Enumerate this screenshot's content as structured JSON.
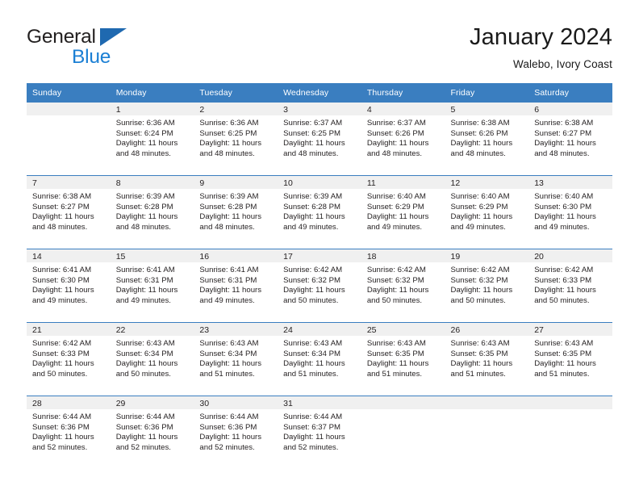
{
  "brand": {
    "name_top": "General",
    "name_bottom": "Blue",
    "triangle_color": "#1f69b0",
    "blue_color": "#1b7fd4"
  },
  "header": {
    "title": "January 2024",
    "subtitle": "Walebo, Ivory Coast"
  },
  "theme": {
    "header_row_bg": "#3a7ec0",
    "daynum_band_bg": "#f0f0f0",
    "grid_line": "#3a7ec0",
    "text": "#231f20"
  },
  "calendar": {
    "weekday_headers": [
      "Sunday",
      "Monday",
      "Tuesday",
      "Wednesday",
      "Thursday",
      "Friday",
      "Saturday"
    ],
    "weeks": [
      [
        {
          "day": "",
          "sunrise": "",
          "sunset": "",
          "daylight1": "",
          "daylight2": ""
        },
        {
          "day": "1",
          "sunrise": "Sunrise: 6:36 AM",
          "sunset": "Sunset: 6:24 PM",
          "daylight1": "Daylight: 11 hours",
          "daylight2": "and 48 minutes."
        },
        {
          "day": "2",
          "sunrise": "Sunrise: 6:36 AM",
          "sunset": "Sunset: 6:25 PM",
          "daylight1": "Daylight: 11 hours",
          "daylight2": "and 48 minutes."
        },
        {
          "day": "3",
          "sunrise": "Sunrise: 6:37 AM",
          "sunset": "Sunset: 6:25 PM",
          "daylight1": "Daylight: 11 hours",
          "daylight2": "and 48 minutes."
        },
        {
          "day": "4",
          "sunrise": "Sunrise: 6:37 AM",
          "sunset": "Sunset: 6:26 PM",
          "daylight1": "Daylight: 11 hours",
          "daylight2": "and 48 minutes."
        },
        {
          "day": "5",
          "sunrise": "Sunrise: 6:38 AM",
          "sunset": "Sunset: 6:26 PM",
          "daylight1": "Daylight: 11 hours",
          "daylight2": "and 48 minutes."
        },
        {
          "day": "6",
          "sunrise": "Sunrise: 6:38 AM",
          "sunset": "Sunset: 6:27 PM",
          "daylight1": "Daylight: 11 hours",
          "daylight2": "and 48 minutes."
        }
      ],
      [
        {
          "day": "7",
          "sunrise": "Sunrise: 6:38 AM",
          "sunset": "Sunset: 6:27 PM",
          "daylight1": "Daylight: 11 hours",
          "daylight2": "and 48 minutes."
        },
        {
          "day": "8",
          "sunrise": "Sunrise: 6:39 AM",
          "sunset": "Sunset: 6:28 PM",
          "daylight1": "Daylight: 11 hours",
          "daylight2": "and 48 minutes."
        },
        {
          "day": "9",
          "sunrise": "Sunrise: 6:39 AM",
          "sunset": "Sunset: 6:28 PM",
          "daylight1": "Daylight: 11 hours",
          "daylight2": "and 48 minutes."
        },
        {
          "day": "10",
          "sunrise": "Sunrise: 6:39 AM",
          "sunset": "Sunset: 6:28 PM",
          "daylight1": "Daylight: 11 hours",
          "daylight2": "and 49 minutes."
        },
        {
          "day": "11",
          "sunrise": "Sunrise: 6:40 AM",
          "sunset": "Sunset: 6:29 PM",
          "daylight1": "Daylight: 11 hours",
          "daylight2": "and 49 minutes."
        },
        {
          "day": "12",
          "sunrise": "Sunrise: 6:40 AM",
          "sunset": "Sunset: 6:29 PM",
          "daylight1": "Daylight: 11 hours",
          "daylight2": "and 49 minutes."
        },
        {
          "day": "13",
          "sunrise": "Sunrise: 6:40 AM",
          "sunset": "Sunset: 6:30 PM",
          "daylight1": "Daylight: 11 hours",
          "daylight2": "and 49 minutes."
        }
      ],
      [
        {
          "day": "14",
          "sunrise": "Sunrise: 6:41 AM",
          "sunset": "Sunset: 6:30 PM",
          "daylight1": "Daylight: 11 hours",
          "daylight2": "and 49 minutes."
        },
        {
          "day": "15",
          "sunrise": "Sunrise: 6:41 AM",
          "sunset": "Sunset: 6:31 PM",
          "daylight1": "Daylight: 11 hours",
          "daylight2": "and 49 minutes."
        },
        {
          "day": "16",
          "sunrise": "Sunrise: 6:41 AM",
          "sunset": "Sunset: 6:31 PM",
          "daylight1": "Daylight: 11 hours",
          "daylight2": "and 49 minutes."
        },
        {
          "day": "17",
          "sunrise": "Sunrise: 6:42 AM",
          "sunset": "Sunset: 6:32 PM",
          "daylight1": "Daylight: 11 hours",
          "daylight2": "and 50 minutes."
        },
        {
          "day": "18",
          "sunrise": "Sunrise: 6:42 AM",
          "sunset": "Sunset: 6:32 PM",
          "daylight1": "Daylight: 11 hours",
          "daylight2": "and 50 minutes."
        },
        {
          "day": "19",
          "sunrise": "Sunrise: 6:42 AM",
          "sunset": "Sunset: 6:32 PM",
          "daylight1": "Daylight: 11 hours",
          "daylight2": "and 50 minutes."
        },
        {
          "day": "20",
          "sunrise": "Sunrise: 6:42 AM",
          "sunset": "Sunset: 6:33 PM",
          "daylight1": "Daylight: 11 hours",
          "daylight2": "and 50 minutes."
        }
      ],
      [
        {
          "day": "21",
          "sunrise": "Sunrise: 6:42 AM",
          "sunset": "Sunset: 6:33 PM",
          "daylight1": "Daylight: 11 hours",
          "daylight2": "and 50 minutes."
        },
        {
          "day": "22",
          "sunrise": "Sunrise: 6:43 AM",
          "sunset": "Sunset: 6:34 PM",
          "daylight1": "Daylight: 11 hours",
          "daylight2": "and 50 minutes."
        },
        {
          "day": "23",
          "sunrise": "Sunrise: 6:43 AM",
          "sunset": "Sunset: 6:34 PM",
          "daylight1": "Daylight: 11 hours",
          "daylight2": "and 51 minutes."
        },
        {
          "day": "24",
          "sunrise": "Sunrise: 6:43 AM",
          "sunset": "Sunset: 6:34 PM",
          "daylight1": "Daylight: 11 hours",
          "daylight2": "and 51 minutes."
        },
        {
          "day": "25",
          "sunrise": "Sunrise: 6:43 AM",
          "sunset": "Sunset: 6:35 PM",
          "daylight1": "Daylight: 11 hours",
          "daylight2": "and 51 minutes."
        },
        {
          "day": "26",
          "sunrise": "Sunrise: 6:43 AM",
          "sunset": "Sunset: 6:35 PM",
          "daylight1": "Daylight: 11 hours",
          "daylight2": "and 51 minutes."
        },
        {
          "day": "27",
          "sunrise": "Sunrise: 6:43 AM",
          "sunset": "Sunset: 6:35 PM",
          "daylight1": "Daylight: 11 hours",
          "daylight2": "and 51 minutes."
        }
      ],
      [
        {
          "day": "28",
          "sunrise": "Sunrise: 6:44 AM",
          "sunset": "Sunset: 6:36 PM",
          "daylight1": "Daylight: 11 hours",
          "daylight2": "and 52 minutes."
        },
        {
          "day": "29",
          "sunrise": "Sunrise: 6:44 AM",
          "sunset": "Sunset: 6:36 PM",
          "daylight1": "Daylight: 11 hours",
          "daylight2": "and 52 minutes."
        },
        {
          "day": "30",
          "sunrise": "Sunrise: 6:44 AM",
          "sunset": "Sunset: 6:36 PM",
          "daylight1": "Daylight: 11 hours",
          "daylight2": "and 52 minutes."
        },
        {
          "day": "31",
          "sunrise": "Sunrise: 6:44 AM",
          "sunset": "Sunset: 6:37 PM",
          "daylight1": "Daylight: 11 hours",
          "daylight2": "and 52 minutes."
        },
        {
          "day": "",
          "sunrise": "",
          "sunset": "",
          "daylight1": "",
          "daylight2": ""
        },
        {
          "day": "",
          "sunrise": "",
          "sunset": "",
          "daylight1": "",
          "daylight2": ""
        },
        {
          "day": "",
          "sunrise": "",
          "sunset": "",
          "daylight1": "",
          "daylight2": ""
        }
      ]
    ]
  }
}
